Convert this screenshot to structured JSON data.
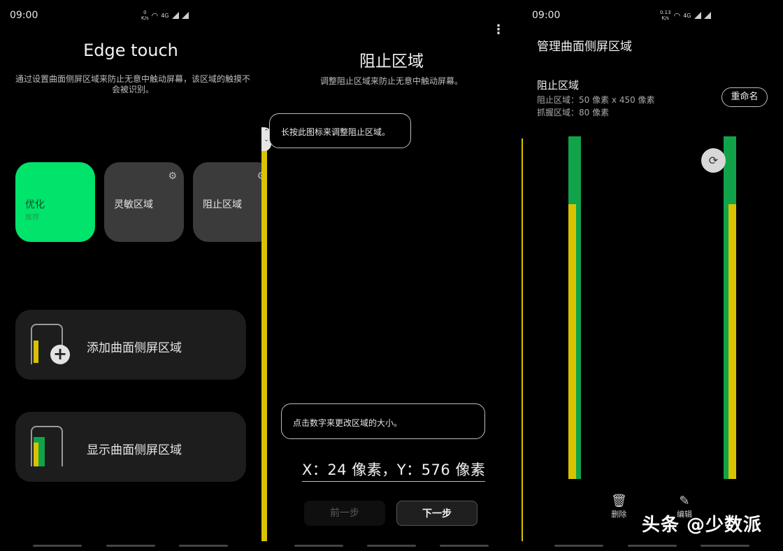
{
  "status": {
    "time": "09:00",
    "speed_p1_top": "0",
    "speed_p1_bottom": "K/s",
    "speed_p3_top": "0.13",
    "speed_p3_bottom": "K/s",
    "network": "4G"
  },
  "panel1": {
    "title": "Edge touch",
    "description": "通过设置曲面侧屏区域来防止无意中触动屏幕，该区域的触摸不会被识别。",
    "tiles": [
      {
        "label": "优化",
        "sub": "推荐",
        "active": true
      },
      {
        "label": "灵敏区域",
        "sub": "",
        "active": false
      },
      {
        "label": "阻止区域",
        "sub": "",
        "active": false
      }
    ],
    "cards": [
      {
        "label": "添加曲面侧屏区域"
      },
      {
        "label": "显示曲面侧屏区域"
      }
    ]
  },
  "panel2": {
    "title": "阻止区域",
    "description": "调整阻止区域来防止无意中触动屏幕。",
    "tip_handle": "长按此图标来调整阻止区域。",
    "tip_numbers": "点击数字来更改区域的大小。",
    "coordinates": "X：24 像素，Y：576 像素",
    "prev_label": "前一步",
    "next_label": "下一步"
  },
  "panel3": {
    "title": "管理曲面侧屏区域",
    "zone_name": "阻止区域",
    "block_info": "阻止区域：50 像素 x 450 像素",
    "grip_info": "抓握区域：80 像素",
    "rename_label": "重命名",
    "delete_label": "删除",
    "edit_label": "编辑"
  },
  "watermark": "头条 @少数派",
  "colors": {
    "accent_green": "#00e46b",
    "block_yellow": "#d9c300",
    "grip_green": "#11a34a"
  }
}
